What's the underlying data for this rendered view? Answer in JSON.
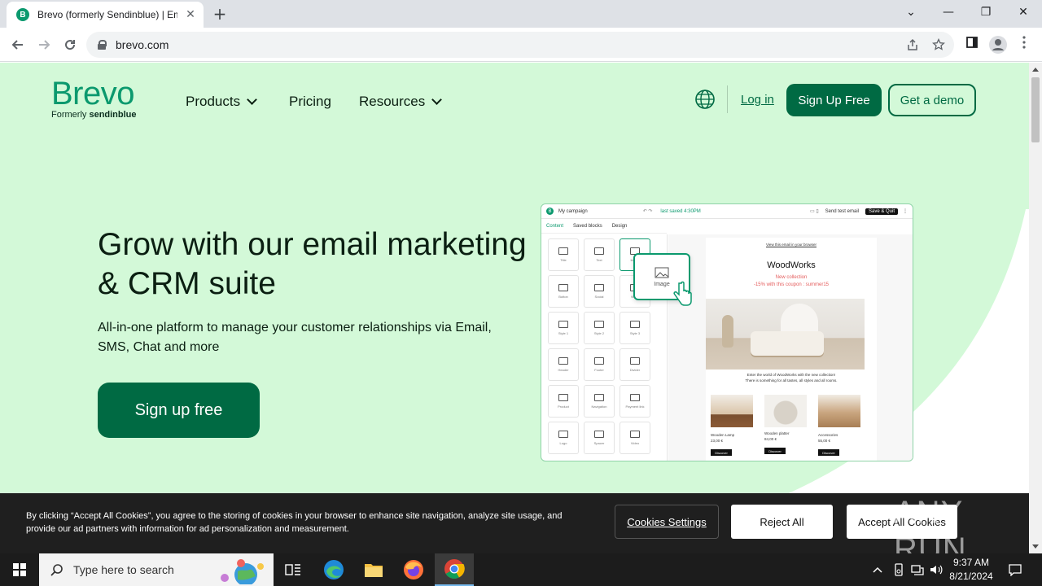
{
  "browser": {
    "tab_title": "Brevo (formerly Sendinblue) | Em",
    "tab_favicon_letter": "B",
    "tab_close": "✕",
    "new_tab": "+",
    "url": "brevo.com",
    "window_controls": [
      "⌄",
      "—",
      "❐",
      "✕"
    ]
  },
  "site": {
    "logo_word": "Brevo",
    "logo_sub_prefix": "Formerly ",
    "logo_sub_brand": "sendinblue",
    "nav": {
      "products": "Products",
      "pricing": "Pricing",
      "resources": "Resources"
    },
    "login": "Log in",
    "signup_button": "Sign Up Free",
    "demo_button": "Get a demo",
    "headline": "Grow with our email marketing & CRM suite",
    "subheadline": "All-in-one platform to manage your customer relationships via Email, SMS, Chat and more",
    "hero_button": "Sign up free",
    "accent_color": "#006a43",
    "background_color": "#d3f9d8"
  },
  "mockup": {
    "campaign_name": "My campaign",
    "last_saved": "last saved 4:30PM",
    "send_test": "Send test email",
    "save_quit": "Save & Quit",
    "tabs": [
      "Content",
      "Saved blocks",
      "Design"
    ],
    "blocks": [
      "Title",
      "Text",
      "Image",
      "Button",
      "Social",
      "Video",
      "Style 1",
      "Style 2",
      "Style 3",
      "Header",
      "Footer",
      "Divider",
      "Product",
      "Navigation",
      "Payment link",
      "Logo",
      "Spacer",
      "Video"
    ],
    "drag_label": "Image",
    "email_view_link": "View this email in your browser",
    "email_brand": "WoodWorks",
    "email_new_collection": "New collection",
    "email_coupon": "-15% with this coupon : summer15",
    "email_intro": "Enter the world of WoodWorks with the new collection!",
    "email_intro2": "There is something for all tastes, all styles and all rooms.",
    "products": [
      {
        "name": "Wooden Lamp",
        "price": "23,00 €",
        "button": "Discover"
      },
      {
        "name": "Wooden platter",
        "price": "84,00 €",
        "button": "Discover"
      },
      {
        "name": "Accessories",
        "price": "55,00 €",
        "button": "Discover"
      }
    ]
  },
  "cookie_banner": {
    "text": "By clicking “Accept All Cookies”, you agree to the storing of cookies in your browser to enhance site navigation, analyze site usage, and provide our ad partners with information for ad personalization and measurement.",
    "settings": "Cookies Settings",
    "reject": "Reject All",
    "accept": "Accept All Cookies",
    "watermark": "ANY RUN"
  },
  "taskbar": {
    "search_placeholder": "Type here to search",
    "time": "9:37 AM",
    "date": "8/21/2024"
  }
}
